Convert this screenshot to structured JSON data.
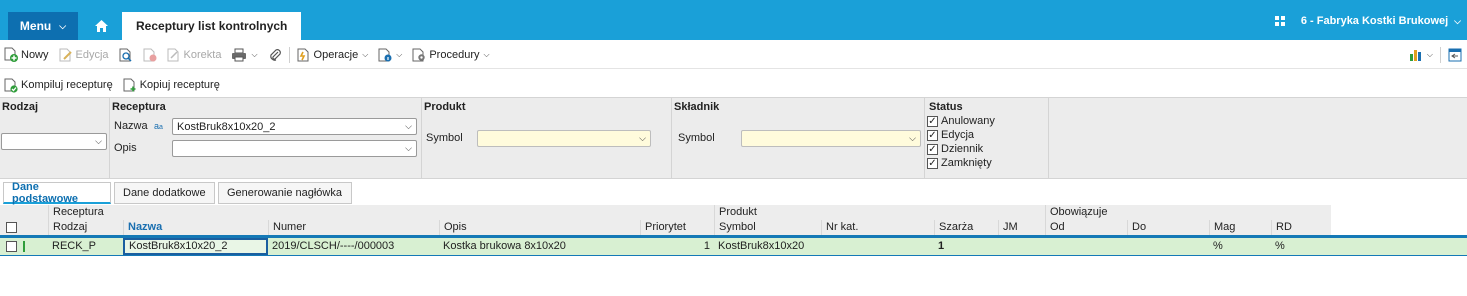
{
  "topbar": {
    "menu_label": "Menu",
    "active_tab": "Receptury list kontrolnych",
    "company": "6 - Fabryka Kostki Brukowej"
  },
  "toolbar": {
    "new": "Nowy",
    "edit": "Edycja",
    "correct": "Korekta",
    "operations": "Operacje",
    "procedures": "Procedury"
  },
  "toolbar2": {
    "compile": "Kompiluj recepturę",
    "copy": "Kopiuj recepturę"
  },
  "filters": {
    "rodzaj": {
      "header": "Rodzaj",
      "value": ""
    },
    "receptura": {
      "header": "Receptura",
      "name_label": "Nazwa",
      "name_value": "KostBruk8x10x20_2",
      "desc_label": "Opis",
      "desc_value": ""
    },
    "produkt": {
      "header": "Produkt",
      "symbol_label": "Symbol",
      "symbol_value": ""
    },
    "skladnik": {
      "header": "Składnik",
      "symbol_label": "Symbol",
      "symbol_value": ""
    },
    "status": {
      "header": "Status",
      "options": [
        {
          "label": "Anulowany",
          "checked": true
        },
        {
          "label": "Edycja",
          "checked": true
        },
        {
          "label": "Dziennik",
          "checked": true
        },
        {
          "label": "Zamknięty",
          "checked": true
        }
      ]
    }
  },
  "subtabs": [
    "Dane podstawowe",
    "Dane dodatkowe",
    "Generowanie nagłówka"
  ],
  "grid": {
    "groups": {
      "receptura": "Receptura",
      "produkt": "Produkt",
      "obowiazuje": "Obowiązuje"
    },
    "columns": [
      "Rodzaj",
      "Nazwa",
      "Numer",
      "Opis",
      "Priorytet",
      "Symbol",
      "Nr kat.",
      "Szarża",
      "JM",
      "Od",
      "Do",
      "Mag",
      "RD"
    ],
    "rows": [
      {
        "rodzaj": "RECK_P",
        "nazwa": "KostBruk8x10x20_2",
        "numer": "2019/CLSCH/----/000003",
        "opis": "Kostka brukowa 8x10x20",
        "priorytet": "1",
        "symbol": "KostBruk8x10x20",
        "nr_kat": "",
        "szarza": "1",
        "jm": "",
        "od": "",
        "do": "",
        "mag": "%",
        "rd": "%"
      }
    ]
  },
  "colors": {
    "brand": "#1aa0d8",
    "menu": "#0d6fb0",
    "row_selected": "#d8f0d2"
  }
}
